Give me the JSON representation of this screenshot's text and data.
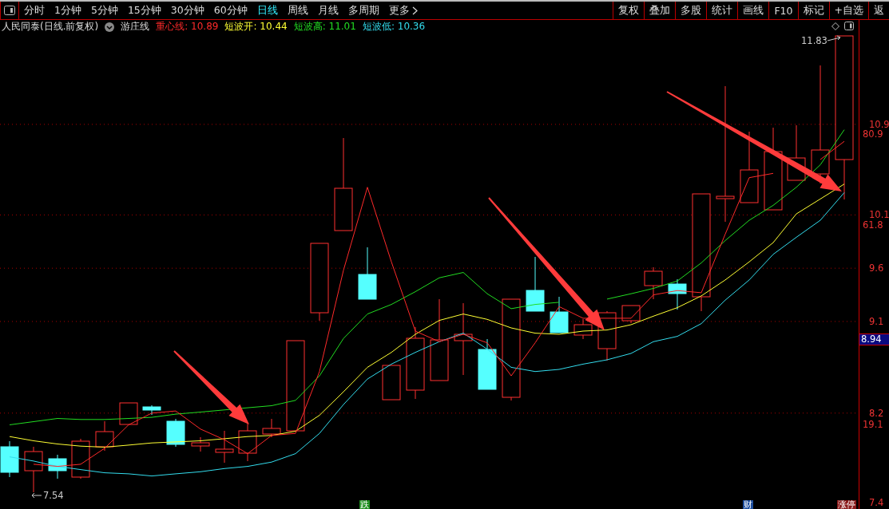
{
  "toolbar": {
    "periods": [
      {
        "label": "分时",
        "selected": false
      },
      {
        "label": "1分钟",
        "selected": false
      },
      {
        "label": "5分钟",
        "selected": false
      },
      {
        "label": "15分钟",
        "selected": false
      },
      {
        "label": "30分钟",
        "selected": false
      },
      {
        "label": "60分钟",
        "selected": false
      },
      {
        "label": "日线",
        "selected": true
      },
      {
        "label": "周线",
        "selected": false
      },
      {
        "label": "月线",
        "selected": false
      },
      {
        "label": "多周期",
        "selected": false
      },
      {
        "label": "更多",
        "selected": false
      }
    ],
    "actions": [
      "复权",
      "叠加",
      "多股",
      "统计",
      "画线",
      "F10",
      "标记",
      "+自选",
      "返"
    ]
  },
  "info": {
    "stock": "人民同泰(日线.前复权)",
    "indicator": "游庄线",
    "values": [
      {
        "label": "重心线:",
        "value": "10.89",
        "color": "#ff2a2a"
      },
      {
        "label": "短波开:",
        "value": "10.44",
        "color": "#ffff33"
      },
      {
        "label": "短波高:",
        "value": "11.01",
        "color": "#22dd22"
      },
      {
        "label": "短波低:",
        "value": "10.36",
        "color": "#33ddee"
      }
    ]
  },
  "chart": {
    "high_label": "11.83",
    "low_label": "7.54",
    "price_tag": "8.94",
    "percent_labels": [
      "80.9",
      "61.8",
      "19.1"
    ],
    "markers": [
      {
        "text": "跌",
        "color": "#1f8f1f"
      },
      {
        "text": "财",
        "color": "#1f4f9f"
      },
      {
        "text": "涨停",
        "color": "#8a1a1a"
      }
    ],
    "chart_data": {
      "type": "line",
      "grid": true,
      "ylim": [
        7.34,
        11.93
      ],
      "yticks": [
        {
          "value": 10.95,
          "label": "10.9"
        },
        {
          "value": 10.1,
          "label": "10.1"
        },
        {
          "value": 9.6,
          "label": "9.6"
        },
        {
          "value": 9.1,
          "label": "9.1"
        },
        {
          "value": 8.24,
          "label": "8.2"
        },
        {
          "value": 7.4,
          "label": "7.4"
        }
      ],
      "series": [
        {
          "color": "#22dd22",
          "values": [
            8.13,
            8.16,
            8.19,
            8.18,
            8.18,
            8.19,
            8.2,
            8.23,
            8.25,
            8.27,
            8.29,
            8.31,
            8.36,
            8.59,
            8.94,
            9.17,
            9.26,
            9.38,
            9.51,
            9.56,
            9.36,
            9.22,
            9.26,
            9.28,
            null,
            9.31,
            9.36,
            9.41,
            9.48,
            9.65,
            9.86,
            10.05,
            10.19,
            10.36,
            10.57,
            10.9
          ]
        },
        {
          "color": "#ffff33",
          "values": [
            8.02,
            7.98,
            7.95,
            7.93,
            7.92,
            7.94,
            7.96,
            7.97,
            7.98,
            8.0,
            8.02,
            8.03,
            8.07,
            8.22,
            8.44,
            8.67,
            8.81,
            8.98,
            9.11,
            9.17,
            9.12,
            9.04,
            8.99,
            8.98,
            9.01,
            9.02,
            9.07,
            9.15,
            9.23,
            9.34,
            9.49,
            9.66,
            9.84,
            10.11,
            10.25,
            10.39
          ]
        },
        {
          "color": "#33ddee",
          "values": [
            7.83,
            7.79,
            7.74,
            7.71,
            7.68,
            7.67,
            7.65,
            7.67,
            7.69,
            7.72,
            7.74,
            7.78,
            7.86,
            8.05,
            8.32,
            8.56,
            8.7,
            8.81,
            8.91,
            8.99,
            8.84,
            8.67,
            8.63,
            8.65,
            8.7,
            8.74,
            8.8,
            8.91,
            8.96,
            9.08,
            9.3,
            9.49,
            9.73,
            9.89,
            10.05,
            10.31
          ]
        },
        {
          "color": "#ff2a2a",
          "values": [
            null,
            7.76,
            7.74,
            7.76,
            7.91,
            8.13,
            8.24,
            8.26,
            8.09,
            7.99,
            7.86,
            8.03,
            8.05,
            8.63,
            9.58,
            10.36,
            9.66,
            9.01,
            8.91,
            8.98,
            8.9,
            8.59,
            8.9,
            9.24,
            9.13,
            9.13,
            9.13,
            9.35,
            9.39,
            9.37,
            9.92,
            10.45,
            10.49,
            null,
            10.62,
            10.79
          ]
        }
      ]
    }
  }
}
